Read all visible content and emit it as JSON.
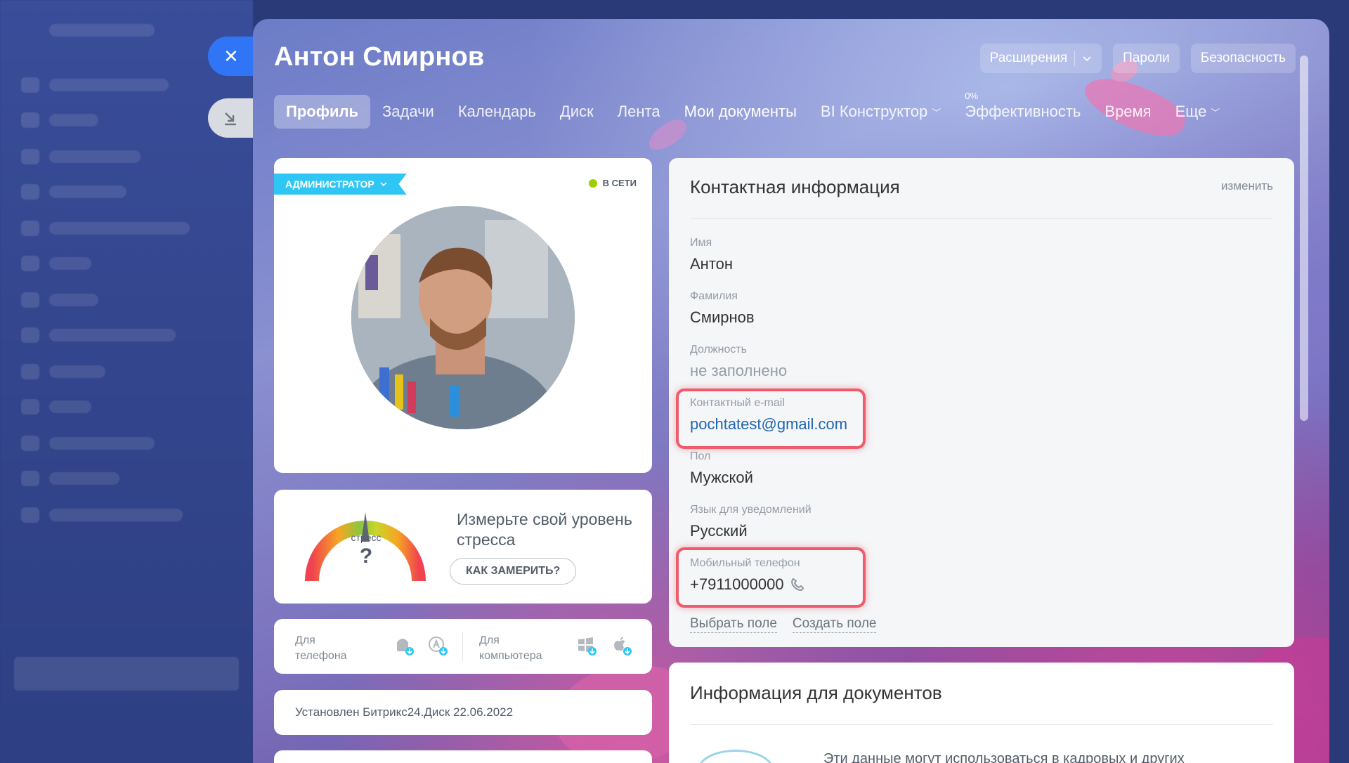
{
  "header": {
    "title": "Антон Смирнов",
    "actions": {
      "extensions": "Расширения",
      "passwords": "Пароли",
      "security": "Безопасность"
    }
  },
  "tabs": [
    {
      "label": "Профиль",
      "active": true
    },
    {
      "label": "Задачи"
    },
    {
      "label": "Календарь"
    },
    {
      "label": "Диск"
    },
    {
      "label": "Лента"
    },
    {
      "label": "Мои документы"
    },
    {
      "label": "BI Конструктор"
    },
    {
      "label": "Эффективность",
      "badge": "0%"
    },
    {
      "label": "Время"
    },
    {
      "label": "Еще"
    }
  ],
  "profile": {
    "role": "АДМИНИСТРАТОР",
    "status": "В СЕТИ"
  },
  "stress": {
    "gauge_label": "стресс",
    "gauge_value": "?",
    "title": "Измерьте свой уровень стресса",
    "button": "КАК ЗАМЕРИТЬ?"
  },
  "apps": {
    "phone_label": "Для телефона",
    "computer_label": "Для компьютера"
  },
  "disk": {
    "text": "Установлен Битрикс24.Диск 22.06.2022"
  },
  "contact": {
    "title": "Контактная информация",
    "edit": "изменить",
    "fields": [
      {
        "label": "Имя",
        "value": "Антон"
      },
      {
        "label": "Фамилия",
        "value": "Смирнов"
      },
      {
        "label": "Должность",
        "value": "не заполнено"
      },
      {
        "label": "Контактный e-mail",
        "value": "pochtatest@gmail.com"
      },
      {
        "label": "Пол",
        "value": "Мужской"
      },
      {
        "label": "Язык для уведомлений",
        "value": "Русский"
      },
      {
        "label": "Мобильный телефон",
        "value": "+7911000000"
      }
    ],
    "choose_field": "Выбрать поле",
    "create_field": "Создать поле"
  },
  "docs": {
    "title": "Информация для документов",
    "text": "Эти данные могут использоваться в кадровых и других"
  },
  "colors": {
    "accent_blue": "#2f75f5",
    "role_badge": "#2fc6f6",
    "online_dot": "#9dcf00",
    "highlight": "#ee5b6b",
    "link": "#2067b0"
  }
}
